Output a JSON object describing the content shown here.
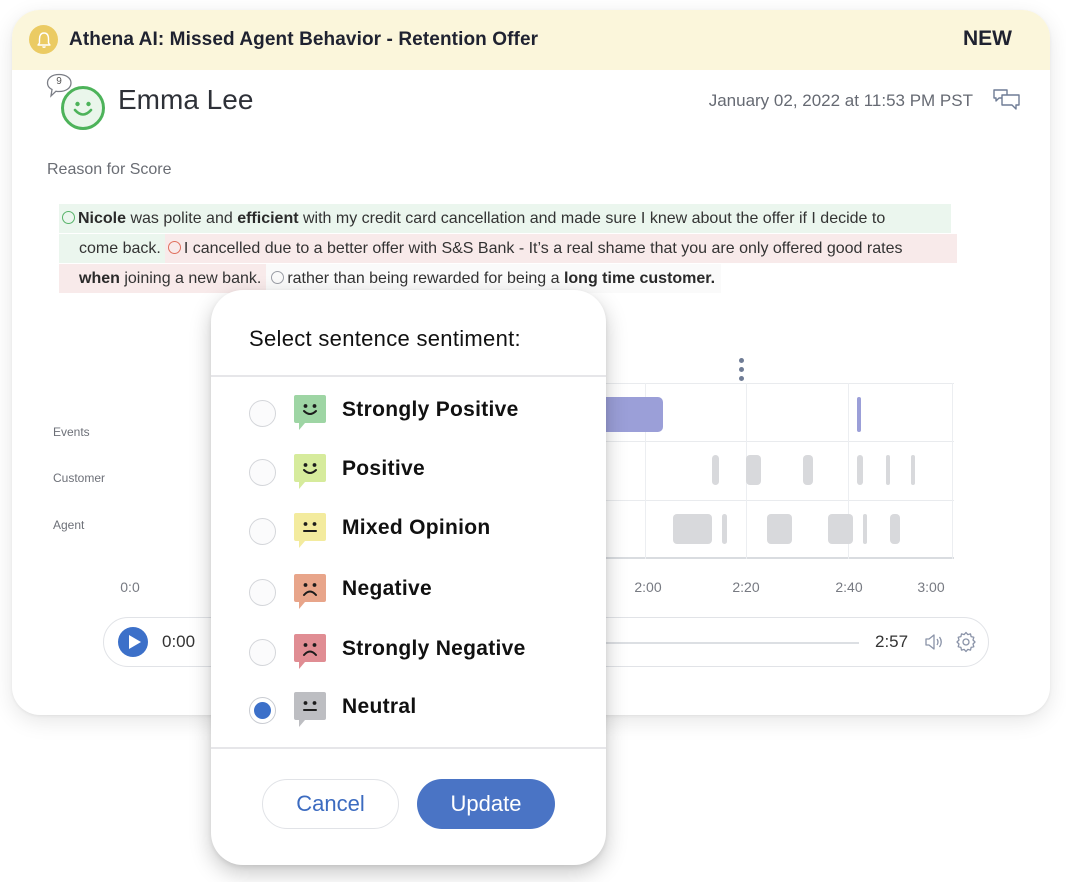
{
  "alert": {
    "icon": "bell-icon",
    "title": "Athena AI: Missed Agent Behavior - Retention Offer",
    "badge": "NEW"
  },
  "customer": {
    "name": "Emma Lee",
    "sentiment": "positive",
    "comment_count": "9",
    "timestamp": "January 02, 2022 at 11:53 PM PST"
  },
  "reason": {
    "label": "Reason for Score",
    "sentences": [
      {
        "sentiment": "positive",
        "parts": [
          {
            "text": "Nicole",
            "bold": true
          },
          {
            "text": " was polite and ",
            "bold": false
          },
          {
            "text": "efficient",
            "bold": true
          },
          {
            "text": " with my credit card cancellation and made sure I knew about the offer if I decide to",
            "bold": false
          },
          {
            "text": "come back.",
            "bold": false
          }
        ]
      },
      {
        "sentiment": "negative",
        "parts": [
          {
            "text": "I cancelled due to a better offer with S&S Bank - It’s a real shame that you are only offered good rates",
            "bold": false
          },
          {
            "text": "when",
            "bold": true
          },
          {
            "text": " joining a new bank.",
            "bold": false
          }
        ]
      },
      {
        "sentiment": "neutral",
        "parts": [
          {
            "text": "rather than being rewarded for being a ",
            "bold": false
          },
          {
            "text": "long time customer.",
            "bold": true
          }
        ]
      }
    ]
  },
  "timeline": {
    "rows": [
      "Events",
      "Customer",
      "Agent"
    ],
    "ticks": [
      "0:0",
      "2:00",
      "2:20",
      "2:40",
      "3:00"
    ],
    "tick_seconds": [
      0,
      120,
      140,
      160,
      180
    ],
    "event_color": "#9B9FD8",
    "segment_color": "#D8D9DC",
    "events": [
      {
        "start": 100,
        "end": 123
      },
      {
        "start": 162,
        "end": 163
      }
    ],
    "customer_segments": [
      {
        "start": 133,
        "end": 134.5
      },
      {
        "start": 140,
        "end": 143
      },
      {
        "start": 151,
        "end": 153
      },
      {
        "start": 162,
        "end": 163.5
      },
      {
        "start": 169,
        "end": 169.6
      },
      {
        "start": 175,
        "end": 175.6
      }
    ],
    "agent_segments": [
      {
        "start": 125,
        "end": 133
      },
      {
        "start": 135,
        "end": 136.2
      },
      {
        "start": 144,
        "end": 149
      },
      {
        "start": 156,
        "end": 161
      },
      {
        "start": 163.5,
        "end": 164
      },
      {
        "start": 170,
        "end": 172.5
      }
    ]
  },
  "player": {
    "current_time": "0:00",
    "total_time": "2:57",
    "progress": 0,
    "accent": "#3C70C9"
  },
  "popup": {
    "title": "Select sentence sentiment:",
    "selected": "Neutral",
    "options": [
      {
        "label": "Strongly Positive",
        "icon": "strongly-positive-face-icon",
        "color": "#9ED5A4",
        "face": "smile",
        "checked": false
      },
      {
        "label": "Positive",
        "icon": "positive-face-icon",
        "color": "#D6EB9C",
        "face": "smile",
        "checked": false
      },
      {
        "label": "Mixed Opinion",
        "icon": "mixed-opinion-face-icon",
        "color": "#F3EB9E",
        "face": "flat",
        "checked": false
      },
      {
        "label": "Negative",
        "icon": "negative-face-icon",
        "color": "#E8A58A",
        "face": "frown",
        "checked": false
      },
      {
        "label": "Strongly Negative",
        "icon": "strongly-negative-face-icon",
        "color": "#E08D93",
        "face": "frown",
        "checked": false
      },
      {
        "label": "Neutral",
        "icon": "neutral-face-icon",
        "color": "#BDBEC2",
        "face": "flat",
        "checked": true
      }
    ],
    "cancel_label": "Cancel",
    "update_label": "Update"
  }
}
